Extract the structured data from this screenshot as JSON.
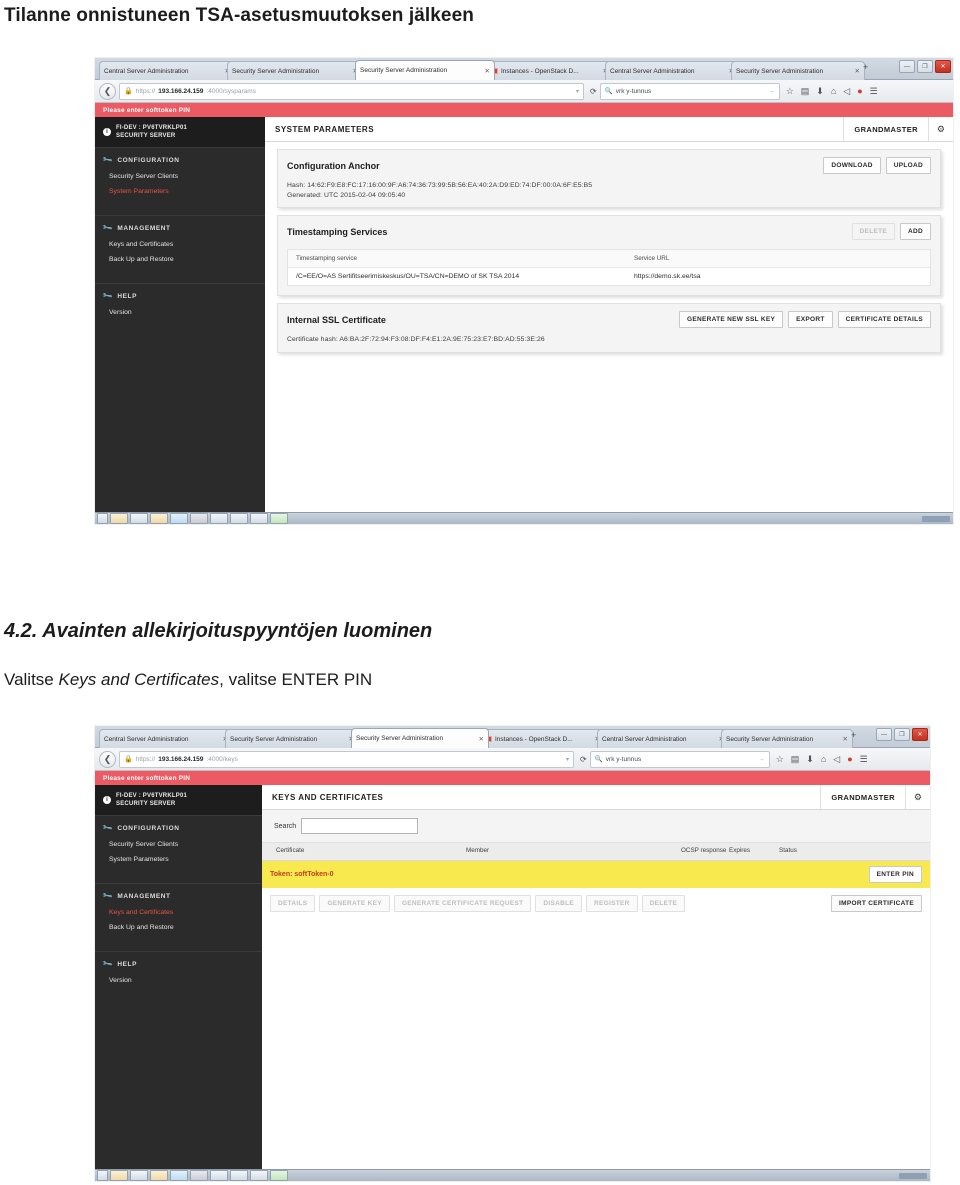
{
  "document": {
    "title": "Tilanne onnistuneen TSA-asetusmuutoksen jälkeen",
    "section_number": "4.2.",
    "section_heading": "Avainten allekirjoituspyyntöjen luominen",
    "body_prefix": "Valitse ",
    "body_emphasis": "Keys and Certificates",
    "body_suffix": ", valitse ENTER PIN"
  },
  "colors": {
    "alert_red": "#ec5b63",
    "sidebar_dark": "#2b2b2b",
    "sidebar_header": "#1d1d1d",
    "active_item_red": "#e8544f",
    "token_yellow": "#f7e94e",
    "token_text_red": "#c23b22"
  },
  "browser": {
    "tabs": [
      {
        "label": "Central Server Administration",
        "active": false,
        "favicon": false
      },
      {
        "label": "Security Server Administration",
        "active": false,
        "favicon": false
      },
      {
        "label": "Security Server Administration",
        "active": true,
        "favicon": false
      },
      {
        "label": "Instances - OpenStack D...",
        "active": false,
        "favicon": true
      },
      {
        "label": "Central Server Administration",
        "active": false,
        "favicon": false
      },
      {
        "label": "Security Server Administration",
        "active": false,
        "favicon": false
      }
    ],
    "new_tab_label": "+",
    "tab_close_glyph": "✕",
    "window_buttons": {
      "minimize": "—",
      "maximize": "❐",
      "close": "✕"
    },
    "back_glyph": "❮",
    "lock_glyph": "🔒",
    "url_caret": "▾",
    "reload_glyph": "⟳",
    "search_value": "vrk y-tunnus",
    "search_glyph": "🔍",
    "search_go": "→",
    "toolbar_icons": [
      "bookmark-star-icon",
      "reading-list-icon",
      "downloads-icon",
      "home-icon",
      "send-icon",
      "pocket-icon",
      "menu-icon"
    ],
    "toolbar_glyphs": [
      "☆",
      "▤",
      "⬇",
      "⌂",
      "◁",
      "●",
      "☰"
    ]
  },
  "app": {
    "alert": "Please enter softtoken PIN",
    "server_name": "FI-DEV : PV6TVRKLP01",
    "server_role": "SECURITY SERVER",
    "server_badge": "i",
    "user": "GRANDMASTER",
    "gear_glyph": "⚙",
    "sidebar": [
      {
        "type": "group",
        "label": "CONFIGURATION",
        "icon": "wrench-icon"
      },
      {
        "type": "item",
        "label": "Security Server Clients"
      },
      {
        "type": "item",
        "label": "System Parameters"
      },
      {
        "type": "group",
        "label": "MANAGEMENT",
        "icon": "wrench-icon"
      },
      {
        "type": "item",
        "label": "Keys and Certificates"
      },
      {
        "type": "item",
        "label": "Back Up and Restore"
      },
      {
        "type": "group",
        "label": "HELP",
        "icon": "wrench-icon"
      },
      {
        "type": "item",
        "label": "Version"
      }
    ]
  },
  "screenshot1": {
    "url_host": "193.166.24.159",
    "url_scheme": "https://",
    "url_rest": ":4000/sysparams",
    "page_title": "SYSTEM PARAMETERS",
    "active_sidebar_item": "System Parameters",
    "anchor": {
      "title": "Configuration Anchor",
      "download_label": "DOWNLOAD",
      "upload_label": "UPLOAD",
      "hash": "Hash: 14:62:F9:E8:FC:17:16:00:9F:A6:74:36:73:99:5B:56:EA:40:2A:D9:ED:74:DF:00:0A:6F:E5:B5",
      "generated": "Generated: UTC 2015-02-04 09:05:40"
    },
    "timestamping": {
      "title": "Timestamping Services",
      "delete_label": "DELETE",
      "add_label": "ADD",
      "columns": [
        "Timestamping service",
        "Service URL"
      ],
      "rows": [
        [
          "/C=EE/O=AS Sertifitseerimiskeskus/OU=TSA/CN=DEMO of SK TSA 2014",
          "https://demo.sk.ee/tsa"
        ]
      ]
    },
    "ssl": {
      "title": "Internal SSL Certificate",
      "generate_label": "GENERATE NEW SSL KEY",
      "export_label": "EXPORT",
      "details_label": "CERTIFICATE DETAILS",
      "hash": "Certificate hash: A6:BA:2F:72:94:F3:08:DF:F4:E1:2A:9E:75:23:E7:BD:AD:55:3E:26"
    }
  },
  "screenshot2": {
    "url_host": "193.166.24.159",
    "url_scheme": "https://",
    "url_rest": ":4000/keys",
    "page_title": "KEYS AND CERTIFICATES",
    "active_sidebar_item": "Keys and Certificates",
    "search_label": "Search",
    "search_value": "",
    "columns": [
      "Certificate",
      "Member",
      "OCSP response",
      "Expires",
      "Status"
    ],
    "token_row": "Token: softToken-0",
    "enter_pin_label": "ENTER PIN",
    "actions": [
      "DETAILS",
      "GENERATE KEY",
      "GENERATE CERTIFICATE REQUEST",
      "DISABLE",
      "REGISTER",
      "DELETE"
    ],
    "import_label": "IMPORT CERTIFICATE"
  }
}
